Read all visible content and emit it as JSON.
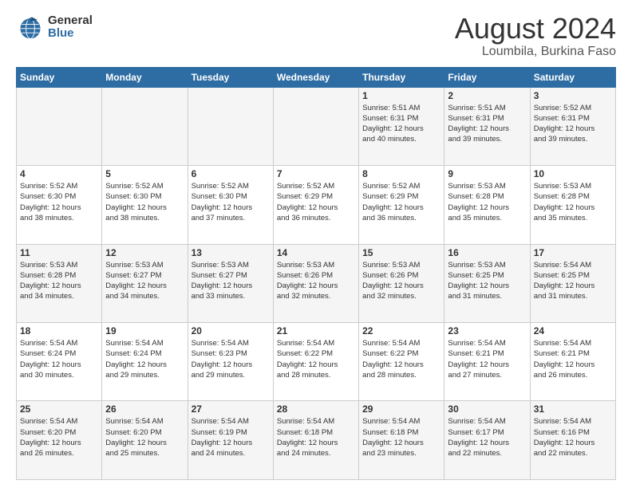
{
  "logo": {
    "line1": "General",
    "line2": "Blue"
  },
  "title": "August 2024",
  "subtitle": "Loumbila, Burkina Faso",
  "days_of_week": [
    "Sunday",
    "Monday",
    "Tuesday",
    "Wednesday",
    "Thursday",
    "Friday",
    "Saturday"
  ],
  "weeks": [
    [
      {
        "day": "",
        "info": ""
      },
      {
        "day": "",
        "info": ""
      },
      {
        "day": "",
        "info": ""
      },
      {
        "day": "",
        "info": ""
      },
      {
        "day": "1",
        "info": "Sunrise: 5:51 AM\nSunset: 6:31 PM\nDaylight: 12 hours\nand 40 minutes."
      },
      {
        "day": "2",
        "info": "Sunrise: 5:51 AM\nSunset: 6:31 PM\nDaylight: 12 hours\nand 39 minutes."
      },
      {
        "day": "3",
        "info": "Sunrise: 5:52 AM\nSunset: 6:31 PM\nDaylight: 12 hours\nand 39 minutes."
      }
    ],
    [
      {
        "day": "4",
        "info": "Sunrise: 5:52 AM\nSunset: 6:30 PM\nDaylight: 12 hours\nand 38 minutes."
      },
      {
        "day": "5",
        "info": "Sunrise: 5:52 AM\nSunset: 6:30 PM\nDaylight: 12 hours\nand 38 minutes."
      },
      {
        "day": "6",
        "info": "Sunrise: 5:52 AM\nSunset: 6:30 PM\nDaylight: 12 hours\nand 37 minutes."
      },
      {
        "day": "7",
        "info": "Sunrise: 5:52 AM\nSunset: 6:29 PM\nDaylight: 12 hours\nand 36 minutes."
      },
      {
        "day": "8",
        "info": "Sunrise: 5:52 AM\nSunset: 6:29 PM\nDaylight: 12 hours\nand 36 minutes."
      },
      {
        "day": "9",
        "info": "Sunrise: 5:53 AM\nSunset: 6:28 PM\nDaylight: 12 hours\nand 35 minutes."
      },
      {
        "day": "10",
        "info": "Sunrise: 5:53 AM\nSunset: 6:28 PM\nDaylight: 12 hours\nand 35 minutes."
      }
    ],
    [
      {
        "day": "11",
        "info": "Sunrise: 5:53 AM\nSunset: 6:28 PM\nDaylight: 12 hours\nand 34 minutes."
      },
      {
        "day": "12",
        "info": "Sunrise: 5:53 AM\nSunset: 6:27 PM\nDaylight: 12 hours\nand 34 minutes."
      },
      {
        "day": "13",
        "info": "Sunrise: 5:53 AM\nSunset: 6:27 PM\nDaylight: 12 hours\nand 33 minutes."
      },
      {
        "day": "14",
        "info": "Sunrise: 5:53 AM\nSunset: 6:26 PM\nDaylight: 12 hours\nand 32 minutes."
      },
      {
        "day": "15",
        "info": "Sunrise: 5:53 AM\nSunset: 6:26 PM\nDaylight: 12 hours\nand 32 minutes."
      },
      {
        "day": "16",
        "info": "Sunrise: 5:53 AM\nSunset: 6:25 PM\nDaylight: 12 hours\nand 31 minutes."
      },
      {
        "day": "17",
        "info": "Sunrise: 5:54 AM\nSunset: 6:25 PM\nDaylight: 12 hours\nand 31 minutes."
      }
    ],
    [
      {
        "day": "18",
        "info": "Sunrise: 5:54 AM\nSunset: 6:24 PM\nDaylight: 12 hours\nand 30 minutes."
      },
      {
        "day": "19",
        "info": "Sunrise: 5:54 AM\nSunset: 6:24 PM\nDaylight: 12 hours\nand 29 minutes."
      },
      {
        "day": "20",
        "info": "Sunrise: 5:54 AM\nSunset: 6:23 PM\nDaylight: 12 hours\nand 29 minutes."
      },
      {
        "day": "21",
        "info": "Sunrise: 5:54 AM\nSunset: 6:22 PM\nDaylight: 12 hours\nand 28 minutes."
      },
      {
        "day": "22",
        "info": "Sunrise: 5:54 AM\nSunset: 6:22 PM\nDaylight: 12 hours\nand 28 minutes."
      },
      {
        "day": "23",
        "info": "Sunrise: 5:54 AM\nSunset: 6:21 PM\nDaylight: 12 hours\nand 27 minutes."
      },
      {
        "day": "24",
        "info": "Sunrise: 5:54 AM\nSunset: 6:21 PM\nDaylight: 12 hours\nand 26 minutes."
      }
    ],
    [
      {
        "day": "25",
        "info": "Sunrise: 5:54 AM\nSunset: 6:20 PM\nDaylight: 12 hours\nand 26 minutes."
      },
      {
        "day": "26",
        "info": "Sunrise: 5:54 AM\nSunset: 6:20 PM\nDaylight: 12 hours\nand 25 minutes."
      },
      {
        "day": "27",
        "info": "Sunrise: 5:54 AM\nSunset: 6:19 PM\nDaylight: 12 hours\nand 24 minutes."
      },
      {
        "day": "28",
        "info": "Sunrise: 5:54 AM\nSunset: 6:18 PM\nDaylight: 12 hours\nand 24 minutes."
      },
      {
        "day": "29",
        "info": "Sunrise: 5:54 AM\nSunset: 6:18 PM\nDaylight: 12 hours\nand 23 minutes."
      },
      {
        "day": "30",
        "info": "Sunrise: 5:54 AM\nSunset: 6:17 PM\nDaylight: 12 hours\nand 22 minutes."
      },
      {
        "day": "31",
        "info": "Sunrise: 5:54 AM\nSunset: 6:16 PM\nDaylight: 12 hours\nand 22 minutes."
      }
    ]
  ]
}
